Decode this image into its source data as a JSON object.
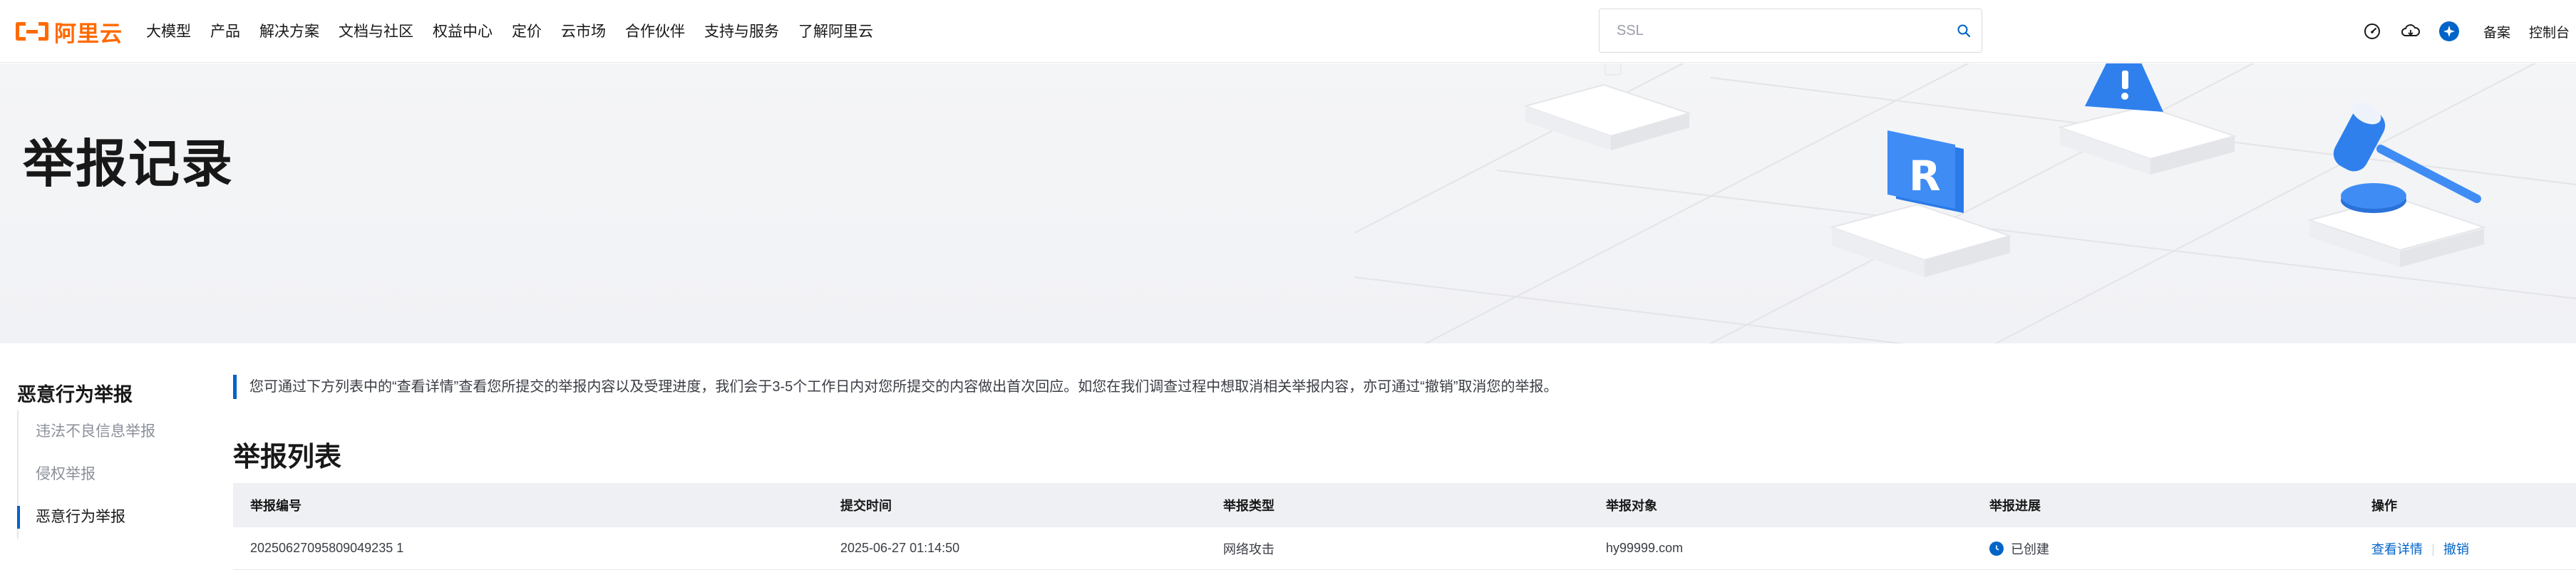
{
  "brand": {
    "name": "阿里云",
    "accent": "#ff6a00",
    "link_color": "#0064c8"
  },
  "nav": {
    "items": [
      {
        "label": "大模型"
      },
      {
        "label": "产品"
      },
      {
        "label": "解决方案"
      },
      {
        "label": "文档与社区"
      },
      {
        "label": "权益中心"
      },
      {
        "label": "定价"
      },
      {
        "label": "云市场"
      },
      {
        "label": "合作伙伴"
      },
      {
        "label": "支持与服务"
      },
      {
        "label": "了解阿里云"
      }
    ]
  },
  "search": {
    "value": "",
    "placeholder": "SSL"
  },
  "header_actions": {
    "icons": [
      "speedometer-icon",
      "cloud-sync-icon",
      "app-switch-icon"
    ],
    "filing_label": "备案",
    "console_label": "控制台"
  },
  "banner": {
    "title": "举报记录"
  },
  "sidebar": {
    "title": "恶意行为举报",
    "items": [
      {
        "label": "违法不良信息举报",
        "active": false
      },
      {
        "label": "侵权举报",
        "active": false
      },
      {
        "label": "恶意行为举报",
        "active": true
      }
    ]
  },
  "notice": "您可通过下方列表中的“查看详情”查看您所提交的举报内容以及受理进度，我们会于3-5个工作日内对您所提交的内容做出首次回应。如您在我们调查过程中想取消相关举报内容，亦可通过“撤销”取消您的举报。",
  "report_list": {
    "title": "举报列表",
    "columns": [
      "举报编号",
      "提交时间",
      "举报类型",
      "举报对象",
      "举报进展",
      "操作"
    ],
    "rows": [
      {
        "id": "20250627095809049235 1",
        "submitted": "2025-06-27 01:14:50",
        "type": "网络攻击",
        "target": "hy99999.com",
        "status": "已创建",
        "actions": [
          "查看详情",
          "撤销"
        ]
      }
    ]
  }
}
